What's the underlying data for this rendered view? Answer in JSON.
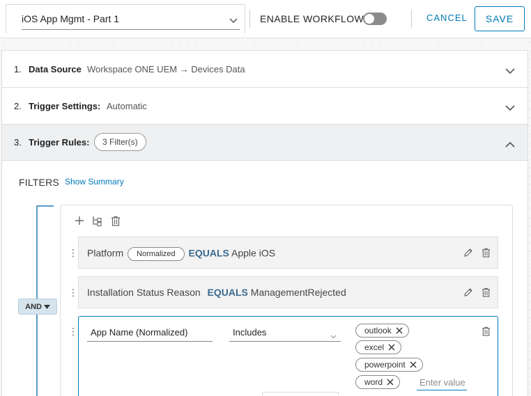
{
  "topbar": {
    "workflow_name": "iOS App Mgmt - Part 1",
    "enable_workflow_label": "ENABLE WORKFLOW",
    "enable_workflow_on": false,
    "cancel_label": "CANCEL",
    "save_label": "SAVE"
  },
  "accordion": [
    {
      "number": "1.",
      "title": "Data Source",
      "value": "Workspace ONE UEM → Devices Data",
      "expanded": false
    },
    {
      "number": "2.",
      "title": "Trigger Settings:",
      "value": "Automatic",
      "expanded": false
    },
    {
      "number": "3.",
      "title": "Trigger Rules:",
      "badge": "3 Filter(s)",
      "expanded": true
    }
  ],
  "filters": {
    "label": "FILTERS",
    "show_summary": "Show Summary",
    "logic_operator": "AND",
    "rules": [
      {
        "attribute": "Platform",
        "badge": "Normalized",
        "operator": "EQUALS",
        "value": "Apple iOS"
      },
      {
        "attribute": "Installation Status Reason",
        "operator": "EQUALS",
        "value": "ManagementRejected"
      }
    ],
    "editing_rule": {
      "attribute": "App Name (Normalized)",
      "operator": "Includes",
      "values": [
        "outlook",
        "excel",
        "powerpoint",
        "word"
      ],
      "input_placeholder": "Enter value"
    }
  },
  "colors": {
    "accent": "#0079b8",
    "operator_text": "#3a6a8e",
    "bracket": "#5b9bc9"
  }
}
